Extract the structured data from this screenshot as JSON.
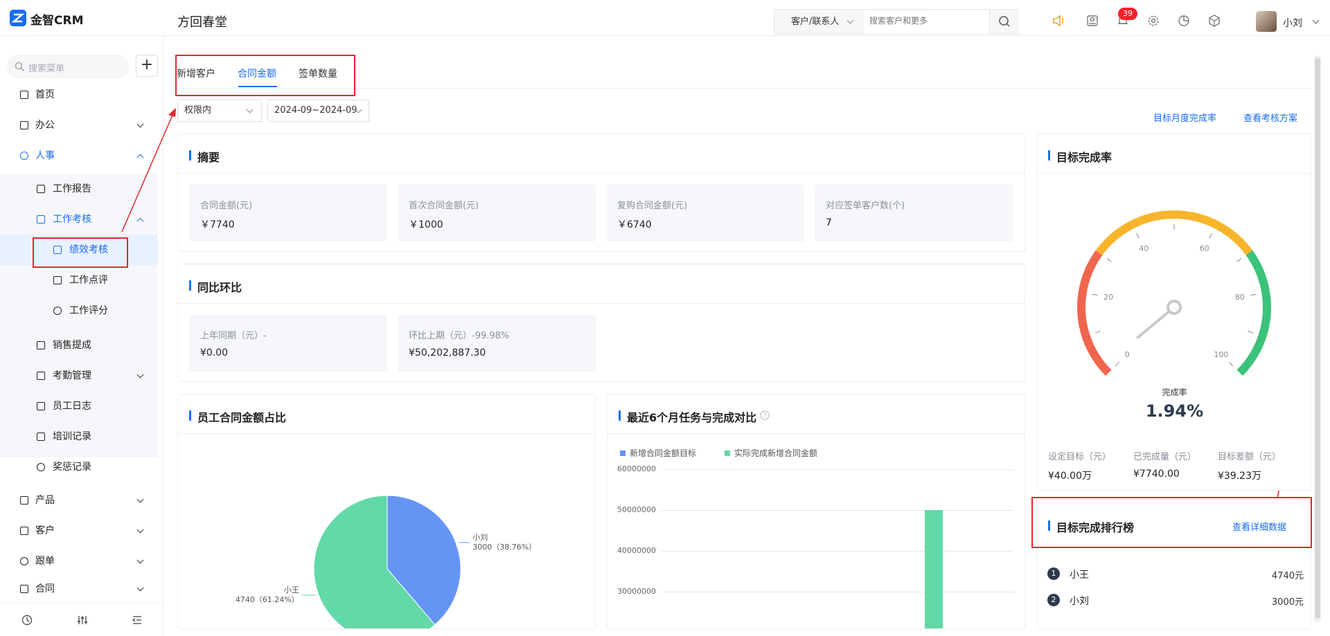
{
  "header": {
    "app_name": "金智CRM",
    "company": "方回春堂",
    "search_scope": "客户/联系人",
    "search_placeholder": "搜索客户和更多",
    "notification_count": "39",
    "username": "小刘"
  },
  "sidebar": {
    "search_placeholder": "搜索菜单",
    "add_label": "+",
    "items": [
      {
        "label": "首页"
      },
      {
        "label": "办公"
      },
      {
        "label": "人事"
      },
      {
        "label": "工作报告"
      },
      {
        "label": "工作考核"
      },
      {
        "label": "绩效考核"
      },
      {
        "label": "工作点评"
      },
      {
        "label": "工作评分"
      },
      {
        "label": "销售提成"
      },
      {
        "label": "考勤管理"
      },
      {
        "label": "员工日志"
      },
      {
        "label": "培训记录"
      },
      {
        "label": "奖惩记录"
      },
      {
        "label": "产品"
      },
      {
        "label": "客户"
      },
      {
        "label": "跟单"
      },
      {
        "label": "合同"
      }
    ]
  },
  "tabs": [
    {
      "label": "新增客户"
    },
    {
      "label": "合同金额"
    },
    {
      "label": "签单数量"
    }
  ],
  "filters": {
    "scope": "权限内",
    "date_range": "2024-09~2024-09"
  },
  "links": {
    "monthly_rate": "目标月度完成率",
    "view_plan": "查看考核方案",
    "view_detail": "查看详细数据"
  },
  "summary": {
    "title": "摘要",
    "stats": [
      {
        "label": "合同金额(元)",
        "value": "￥7740"
      },
      {
        "label": "首次合同金额(元)",
        "value": "￥1000"
      },
      {
        "label": "复购合同金额(元)",
        "value": "￥6740"
      },
      {
        "label": "对应签单客户数(个)",
        "value": "7"
      }
    ]
  },
  "yoy": {
    "title": "同比环比",
    "stats": [
      {
        "label": "上年同期（元）-",
        "value": "¥0.00"
      },
      {
        "label": "环比上期（元）-99.98%",
        "value": "¥50,202,887.30"
      }
    ]
  },
  "pie": {
    "title": "员工合同金额占比",
    "slices": [
      {
        "name": "小刘",
        "value": 3000,
        "text": "3000（38.76%）",
        "color": "#6495f5"
      },
      {
        "name": "小王",
        "value": 4740,
        "text": "4740（61.24%）",
        "color": "#62d9a8"
      }
    ]
  },
  "bar": {
    "title": "最近6个月任务与完成对比",
    "legend": [
      {
        "name": "新增合同金额目标",
        "color": "#6495f5"
      },
      {
        "name": "实际完成新增合同金额",
        "color": "#62d9a8"
      }
    ],
    "yticks": [
      "60000000",
      "50000000",
      "40000000",
      "30000000"
    ]
  },
  "gauge": {
    "title": "目标完成率",
    "caption": "完成率",
    "value_text": "1.94%",
    "ticks": [
      "0",
      "20",
      "40",
      "60",
      "80",
      "100"
    ],
    "stats": [
      {
        "label": "设定目标（元）",
        "value": "¥40.00万"
      },
      {
        "label": "已完成量（元）",
        "value": "¥7740.00"
      },
      {
        "label": "目标差额（元）",
        "value": "¥39.23万"
      }
    ]
  },
  "ranking": {
    "title": "目标完成排行榜",
    "rows": [
      {
        "rank": "1",
        "name": "小王",
        "value": "4740元"
      },
      {
        "rank": "2",
        "name": "小刘",
        "value": "3000元"
      }
    ]
  },
  "chart_data": [
    {
      "type": "pie",
      "title": "员工合同金额占比",
      "slices": [
        {
          "label": "小刘",
          "value": 3000,
          "percent": 38.76
        },
        {
          "label": "小王",
          "value": 4740,
          "percent": 61.24
        }
      ]
    },
    {
      "type": "bar",
      "title": "最近6个月任务与完成对比",
      "series": [
        {
          "name": "新增合同金额目标",
          "values": []
        },
        {
          "name": "实际完成新增合同金额",
          "values": [
            50202887
          ]
        }
      ],
      "ylim": [
        30000000,
        60000000
      ],
      "yticks": [
        30000000,
        40000000,
        50000000,
        60000000
      ],
      "legend": "top-left"
    },
    {
      "type": "gauge",
      "title": "目标完成率",
      "value": 1.94,
      "range": [
        0,
        100
      ]
    }
  ]
}
